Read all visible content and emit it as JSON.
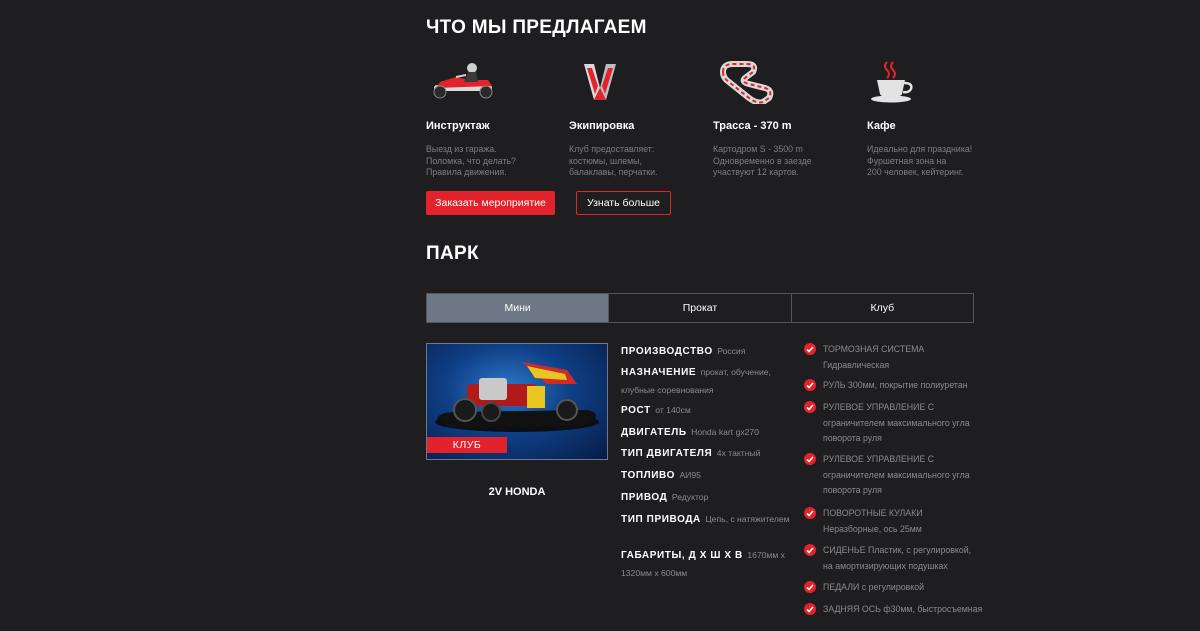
{
  "offer": {
    "heading": "ЧТО МЫ ПРЕДЛАГАЕМ",
    "items": [
      {
        "icon": "kart-driver-icon",
        "title": "Инструктаж",
        "desc": "Выезд из гаража.\nПоломка, что делать?\nПравила движения."
      },
      {
        "icon": "racing-gloves-icon",
        "title": "Экипировка",
        "desc": "Клуб предоставляет:\nкостюмы, шлемы,\nбалаклавы, перчатки."
      },
      {
        "icon": "race-track-icon",
        "title": "Трасса - 370 m",
        "desc": "Картодром S - 3500 m\nОдновременно в заезде\nучаствуют 12 картов."
      },
      {
        "icon": "coffee-cup-icon",
        "title": "Кафе",
        "desc": "Идеально для праздника!\nФуршетная зона на\n200 человек, кейтеринг."
      }
    ],
    "order_button": "Заказать мероприятие",
    "more_button": "Узнать больше"
  },
  "park": {
    "heading": "ПАРК",
    "tabs": [
      "Мини",
      "Прокат",
      "Клуб"
    ],
    "active_tab": "Мини",
    "kart": {
      "badge": "КЛУБ",
      "name": "2V HONDA",
      "specs": [
        {
          "key": "ПРОИЗВОДСТВО",
          "value": "Россия"
        },
        {
          "key": "НАЗНАЧЕНИЕ",
          "value": "прокат, обучение, клубные соревнования"
        },
        {
          "key": "РОСТ",
          "value": "от 140см"
        },
        {
          "key": "ДВИГАТЕЛЬ",
          "value": "Honda kart gx270"
        },
        {
          "key": "ТИП ДВИГАТЕЛЯ",
          "value": "4х тактный"
        },
        {
          "key": "ТОПЛИВО",
          "value": "АИ95"
        },
        {
          "key": "ПРИВОД",
          "value": "Редуктор"
        },
        {
          "key": "ТИП ПРИВОДА",
          "value": "Цепь, с натяжителем"
        },
        {
          "key": "ГАБАРИТЫ, Д Х Ш Х В",
          "value": "1670мм х 1320мм х 600мм"
        }
      ],
      "features": [
        "ТОРМОЗНАЯ СИСТЕМА Гидравлическая",
        "РУЛЬ 300мм, покрытие полиуретан",
        "РУЛЕВОЕ УПРАВЛЕНИЕ С ограничителем максимального угла поворота руля",
        "РУЛЕВОЕ УПРАВЛЕНИЕ С ограничителем максимального угла поворота руля",
        "ПОВОРОТНЫЕ КУЛАКИ Неразборные, ось 25мм",
        "СИДЕНЬЕ Пластик, с регулировкой, на амортизирующих подушках",
        "ПЕДАЛИ с регулировкой",
        "ЗАДНЯЯ ОСЬ ф30мм, быстросъемная"
      ]
    }
  },
  "colors": {
    "background": "#1e1e21",
    "accent": "#e3232c",
    "active_tab": "#6e7886",
    "muted_text": "#8a8a90"
  }
}
